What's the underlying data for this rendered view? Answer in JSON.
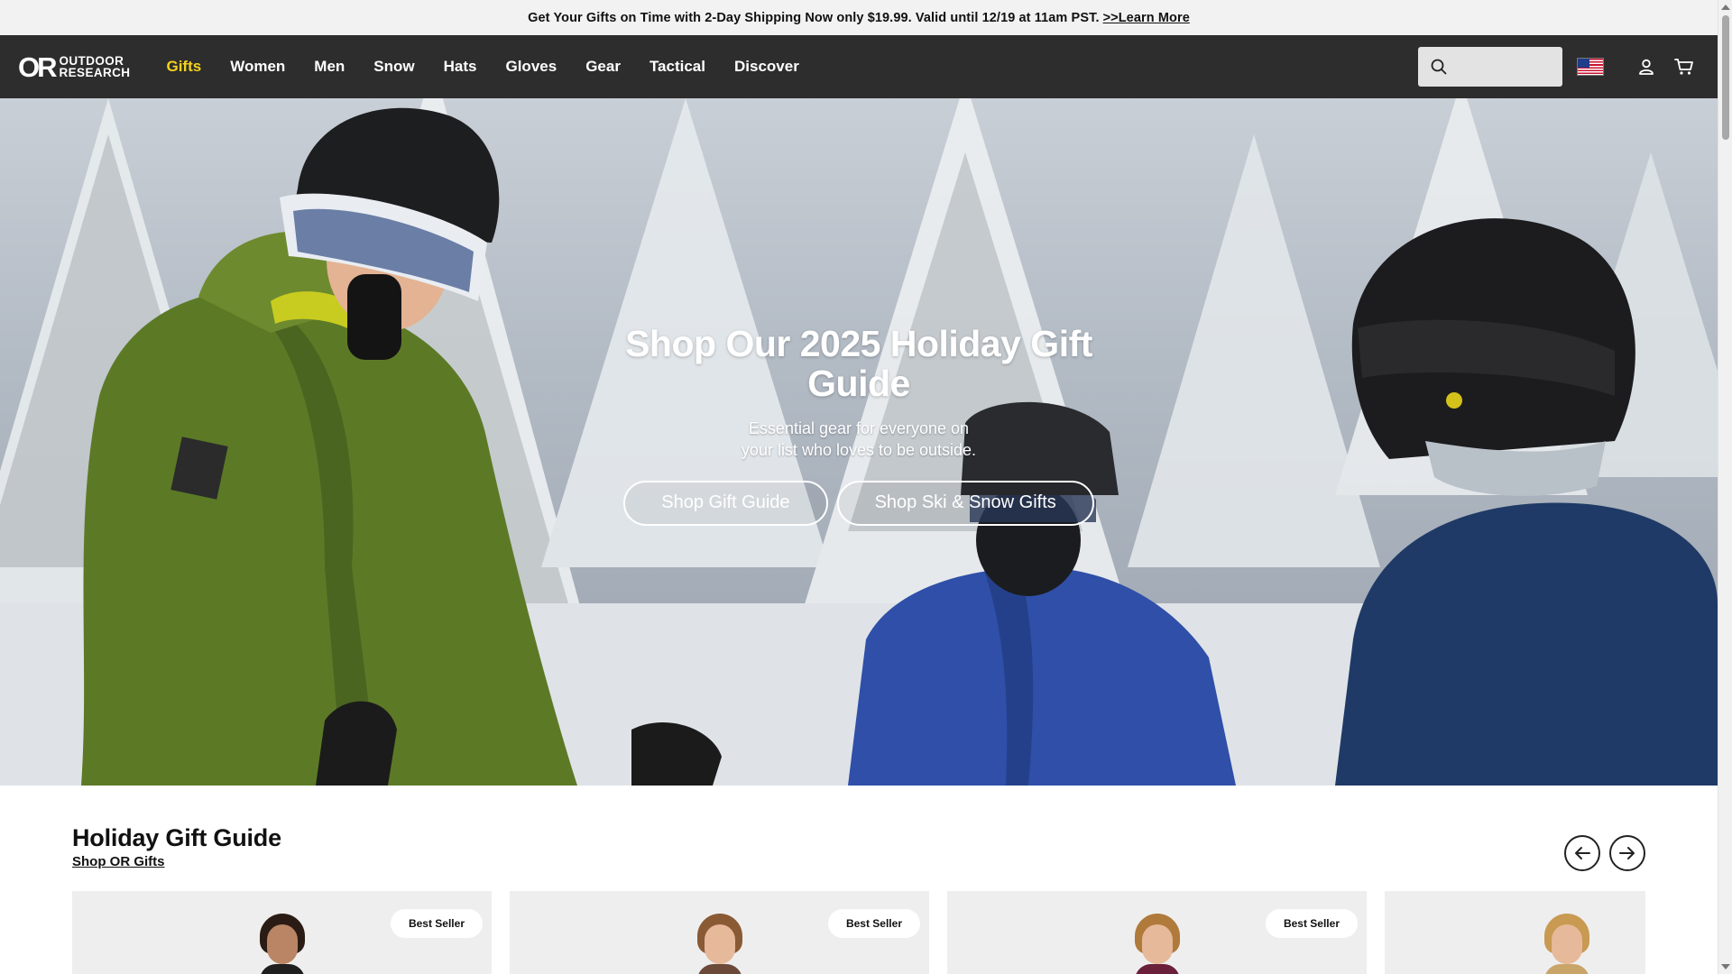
{
  "promo": {
    "text": "Get Your Gifts on Time with 2-Day Shipping Now only $19.99. Valid until 12/19 at 11am PST.",
    "link": ">>Learn More"
  },
  "nav": {
    "logo_mark": "OR",
    "logo_line1": "OUTDOOR",
    "logo_line2": "RESEARCH",
    "links": [
      "Gifts",
      "Women",
      "Men",
      "Snow",
      "Hats",
      "Gloves",
      "Gear",
      "Tactical",
      "Discover"
    ],
    "active_link": "Gifts",
    "search_placeholder": "",
    "active_color": "#f3d21e",
    "bar_color": "#2d2d2d"
  },
  "hero": {
    "title": "Shop Our 2025 Holiday Gift Guide",
    "subtitle": "Essential gear for everyone on your list who loves to be outside.",
    "cta_primary": "Shop Gift Guide",
    "cta_secondary": "Shop Ski & Snow Gifts",
    "jacket_colors": [
      "#5c7a26",
      "#2f4fa8",
      "#1f3a66"
    ]
  },
  "section": {
    "title": "Holiday Gift Guide",
    "link": "Shop OR Gifts",
    "cards": [
      {
        "badge": "Best Seller",
        "hair": "#2a1c14",
        "top": "#1f1f1f"
      },
      {
        "badge": "Best Seller",
        "hair": "#8a5a34",
        "top": "#6b4a3a"
      },
      {
        "badge": "Best Seller",
        "hair": "#b07a3a",
        "top": "#6a1f3b"
      },
      {
        "badge": "",
        "hair": "#c89a52",
        "top": "#c9a56a"
      }
    ]
  },
  "icons": {
    "search": "search-icon",
    "account": "user-icon",
    "cart": "cart-icon",
    "flag": "us-flag-icon",
    "prev": "arrow-left-icon",
    "next": "arrow-right-icon"
  }
}
